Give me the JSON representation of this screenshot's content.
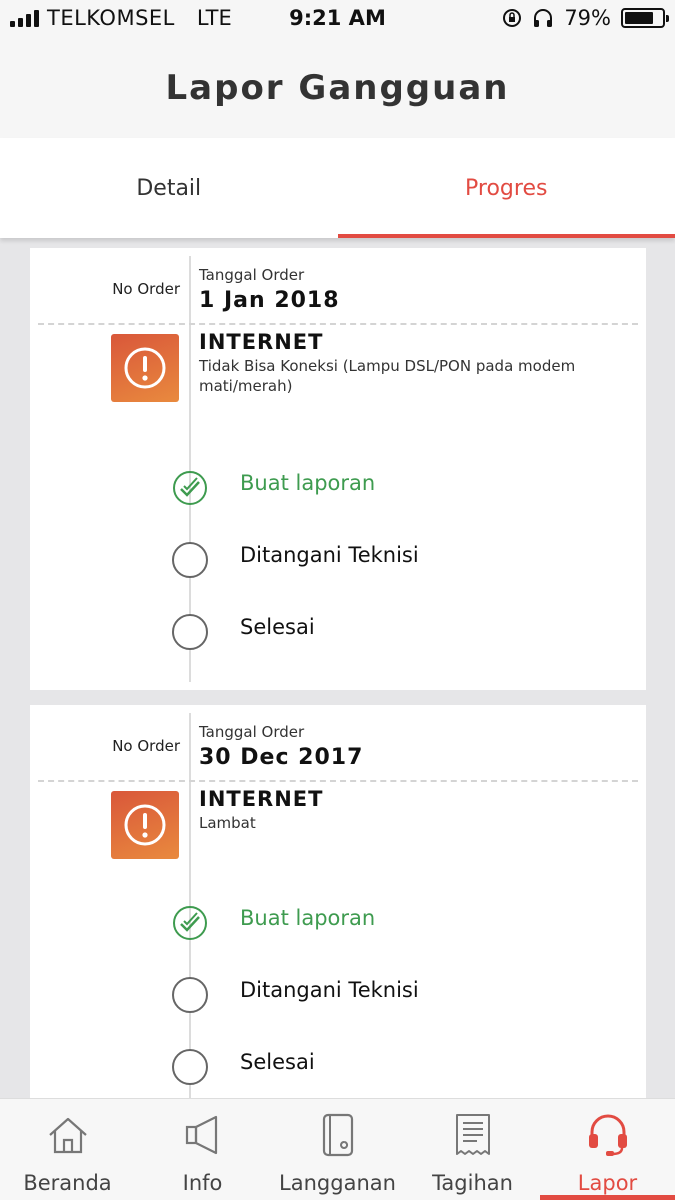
{
  "status": {
    "carrier": "TELKOMSEL",
    "network": "LTE",
    "time": "9:21 AM",
    "battery": "79%",
    "battery_level": 0.79
  },
  "header": {
    "title": "Lapor Gangguan"
  },
  "tabs": [
    {
      "label": "Detail"
    },
    {
      "label": "Progres"
    }
  ],
  "cards": [
    {
      "no_order_label": "No Order",
      "tanggal_label": "Tanggal Order",
      "date": "1 Jan 2018",
      "service": "INTERNET",
      "description": "Tidak Bisa Koneksi (Lampu DSL/PON pada modem mati/merah)",
      "steps": [
        {
          "label": "Buat laporan",
          "done": true
        },
        {
          "label": "Ditangani Teknisi",
          "done": false
        },
        {
          "label": "Selesai",
          "done": false
        }
      ]
    },
    {
      "no_order_label": "No Order",
      "tanggal_label": "Tanggal Order",
      "date": "30 Dec 2017",
      "service": "INTERNET",
      "description": "Lambat",
      "steps": [
        {
          "label": "Buat laporan",
          "done": true
        },
        {
          "label": "Ditangani Teknisi",
          "done": false
        },
        {
          "label": "Selesai",
          "done": false
        }
      ]
    }
  ],
  "nav": [
    {
      "label": "Beranda",
      "icon": "home-icon"
    },
    {
      "label": "Info",
      "icon": "megaphone-icon"
    },
    {
      "label": "Langganan",
      "icon": "book-icon"
    },
    {
      "label": "Tagihan",
      "icon": "receipt-icon"
    },
    {
      "label": "Lapor",
      "icon": "headset-icon"
    }
  ],
  "colors": {
    "accent": "#e24b42",
    "done": "#3e9b4f",
    "alert_from": "#d9573a",
    "alert_to": "#e98a3e"
  }
}
